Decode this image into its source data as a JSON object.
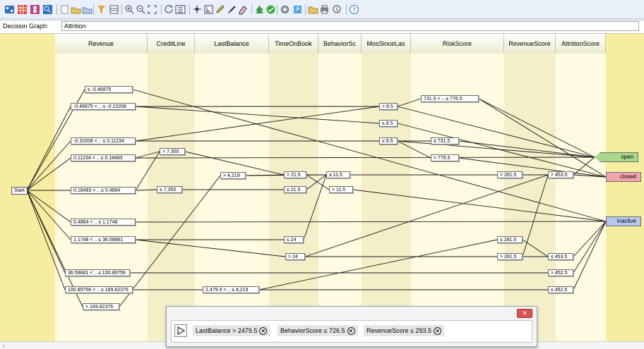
{
  "toolbar": {
    "icons": [
      "flowchart-icon",
      "grid-icon",
      "stack-icon",
      "magnify-icon",
      "new-icon",
      "open-icon",
      "save-icon",
      "filter-icon",
      "table-icon",
      "zoom-in-icon",
      "zoom-out-icon",
      "fit-icon",
      "refresh-icon",
      "sort-icon",
      "pan-icon",
      "select-icon",
      "pencil-icon",
      "brush-icon",
      "eraser-icon",
      "tree-icon",
      "check-icon",
      "gear-icon",
      "export-icon",
      "folder-icon",
      "print-icon",
      "query-icon",
      "help-icon"
    ]
  },
  "header": {
    "label": "Decision Graph:",
    "value": "Attrition"
  },
  "columns": [
    "Revenue",
    "CreditLine",
    "LastBalance",
    "TimeOnBook",
    "BehaviorSc",
    "MosSinceLas",
    "RiskScore",
    "RevenueScore",
    "AttritionScore"
  ],
  "start_label": "Start",
  "nodes": {
    "rev": [
      "≤ -0.46875",
      "-0.46875 < .. ≤ -0.10208",
      "-0.10208 < .. ≤ 0.11234",
      "0.11234 < .. ≤ 0.18493",
      "0.18493 < .. ≤ 0.4864",
      "0.4864 < .. ≤ 1.1748",
      "1.1748 < .. ≤ 36.59881",
      "36.59881 < .. ≤ 100.89756",
      "100.89756 < .. ≤ 169.82376",
      "> 169.82376"
    ],
    "credit": [
      "> 7,350",
      "≤ 7,350"
    ],
    "last": [
      "> 4,219",
      "2,479.5 < .. ≤ 4,219"
    ],
    "tob": [
      "> 21.5",
      "≤ 21.5",
      "≤ 24",
      "> 24"
    ],
    "beh": [
      "≤ 11.5",
      "> 11.5"
    ],
    "mos": [
      "> 8.5",
      "≤ 8.5",
      "≤ 8.5"
    ],
    "risk": [
      "731.5 < .. ≤ 776.5",
      "≤ 731.5",
      "> 776.5"
    ],
    "revscore": [
      "> 281.5",
      "≤ 281.5",
      "> 281.5"
    ],
    "attr": [
      "> 453.5",
      "≤ 453.5",
      "> 452.5",
      "≤ 452.5"
    ]
  },
  "outcomes": {
    "open": "open",
    "closed": "closed",
    "inactive": "inactive"
  },
  "colors": {
    "open": "#a8d98c",
    "closed": "#f3a5ad",
    "inactive": "#b7c9ee",
    "canvas": "#f6eda0"
  },
  "popup": {
    "conditions": [
      "LastBalance > 2479.5",
      "BehaviorScore ≤ 726.5",
      "RevenueScore ≤ 293.5"
    ],
    "close_label": "✕"
  }
}
